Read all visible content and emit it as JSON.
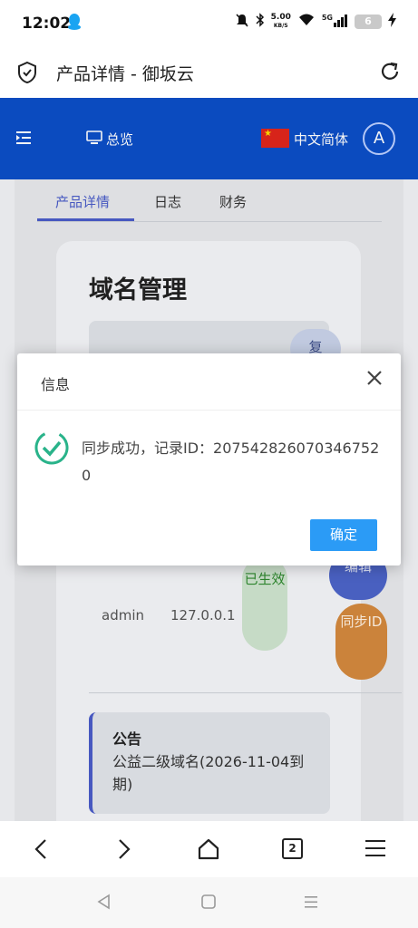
{
  "status_bar": {
    "time": "12:02",
    "net_speed_value": "5.00",
    "net_speed_unit": "KB/S",
    "signal_label": "5G",
    "battery": "6"
  },
  "browser": {
    "page_title": "产品详情 - 御坂云"
  },
  "header": {
    "overview_label": "总览",
    "language_label": "中文简体",
    "avatar_letter": "A"
  },
  "tabs": [
    {
      "label": "产品详情",
      "active": true
    },
    {
      "label": "日志",
      "active": false
    },
    {
      "label": "财务",
      "active": false
    }
  ],
  "card": {
    "title": "域名管理",
    "copy_button": "复",
    "record": {
      "user": "admin",
      "ip": "127.0.0.1",
      "status": "已生效",
      "edit_button": "编辑",
      "sync_button": "同步ID"
    },
    "notice": {
      "title": "公告",
      "body": "公益二级域名(2026-11-04到期)"
    }
  },
  "dialog": {
    "title": "信息",
    "message": "同步成功，记录ID：2075428260703467520",
    "confirm_button": "确定"
  },
  "bottom_nav": {
    "tab_count": "2"
  },
  "colors": {
    "header_blue": "#0c4fc7",
    "accent": "#4a5cc8",
    "confirm_blue": "#2b9bf6",
    "success_green": "#29b38a",
    "sync_orange": "#d4893e"
  }
}
